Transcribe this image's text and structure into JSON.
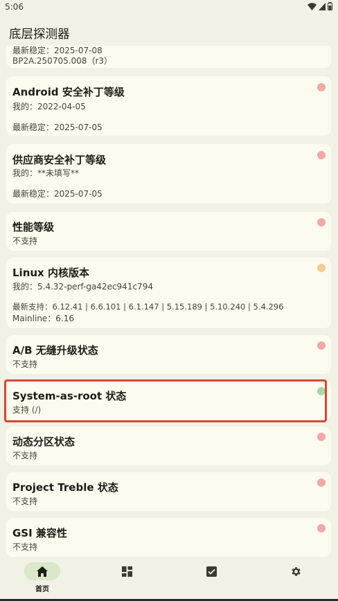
{
  "status_bar": {
    "time": "5:06"
  },
  "app": {
    "title": "底层探测器"
  },
  "colors": {
    "red": "#f6a6a6",
    "orange": "#f8cc8e",
    "green": "#a8d8a8",
    "highlight": "#d44733"
  },
  "cards": {
    "c0": {
      "line1": "最新稳定：2025-07-08",
      "line2": "BP2A.250705.008（r3）"
    },
    "c1": {
      "title": "Android 安全补丁等级",
      "mine": "我的：2022-04-05",
      "latest": "最新稳定：2025-07-05",
      "status": "red"
    },
    "c2": {
      "title": "供应商安全补丁等级",
      "mine": "我的：**未填写**",
      "latest": "最新稳定：2025-07-05",
      "status": "red"
    },
    "c3": {
      "title": "性能等级",
      "value": "不支持",
      "status": "red"
    },
    "c4": {
      "title": "Linux 内核版本",
      "mine": "我的：5.4.32-perf-ga42ec941c794",
      "latest": "最新支持：6.12.41 | 6.6.101 | 6.1.147 | 5.15.189 | 5.10.240 | 5.4.296",
      "mainline": "Mainline：6.16",
      "status": "orange"
    },
    "c5": {
      "title": "A/B 无缝升级状态",
      "value": "不支持",
      "status": "red"
    },
    "c6": {
      "title": "System-as-root 状态",
      "value": "支持 (/)",
      "status": "green"
    },
    "c7": {
      "title": "动态分区状态",
      "value": "不支持",
      "status": "red"
    },
    "c8": {
      "title": "Project Treble 状态",
      "value": "不支持",
      "status": "red"
    },
    "c9": {
      "title": "GSI 兼容性",
      "value": "不支持",
      "status": "red"
    }
  },
  "nav": {
    "home_label": "首页",
    "items": [
      "home-icon",
      "dashboard-icon",
      "checklist-icon",
      "settings-icon"
    ]
  }
}
